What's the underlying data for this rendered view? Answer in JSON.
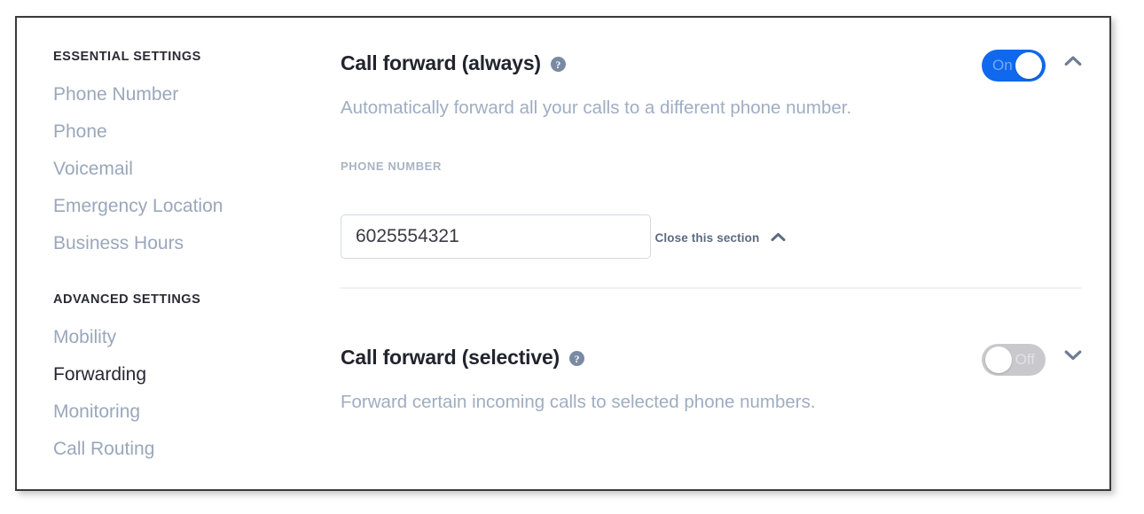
{
  "sidebar": {
    "groups": [
      {
        "title": "ESSENTIAL SETTINGS",
        "items": [
          {
            "label": "Phone Number",
            "active": false
          },
          {
            "label": "Phone",
            "active": false
          },
          {
            "label": "Voicemail",
            "active": false
          },
          {
            "label": "Emergency Location",
            "active": false
          },
          {
            "label": "Business Hours",
            "active": false
          }
        ]
      },
      {
        "title": "ADVANCED SETTINGS",
        "items": [
          {
            "label": "Mobility",
            "active": false
          },
          {
            "label": "Forwarding",
            "active": true
          },
          {
            "label": "Monitoring",
            "active": false
          },
          {
            "label": "Call Routing",
            "active": false
          }
        ]
      }
    ]
  },
  "main": {
    "sections": [
      {
        "title": "Call forward (always)",
        "help_icon": "help-circle-icon",
        "description": "Automatically forward all your calls to a different phone number.",
        "toggle": {
          "state": "on",
          "label": "On"
        },
        "collapse_icon": "chevron-up-icon",
        "expanded": true,
        "field": {
          "label": "PHONE NUMBER",
          "value": "6025554321",
          "placeholder": "Enter phone number"
        },
        "close_link": {
          "label": "Close this section",
          "icon": "chevron-up-icon"
        }
      },
      {
        "title": "Call forward (selective)",
        "help_icon": "help-circle-icon",
        "description": "Forward certain incoming calls to selected phone numbers.",
        "toggle": {
          "state": "off",
          "label": "Off"
        },
        "collapse_icon": "chevron-down-icon",
        "expanded": false
      }
    ]
  },
  "colors": {
    "toggle_on": "#1068ef",
    "toggle_off": "#c9c9cd",
    "sidebar_inactive": "#9aa7bb",
    "sidebar_active": "#272733",
    "description_text": "#9fadc2",
    "help_icon_bg": "#7b8aa3",
    "chevron": "#6d7d95",
    "divider": "#eef0f4",
    "input_border": "#d3dae3"
  },
  "glyphs": {
    "question_mark": "?"
  }
}
